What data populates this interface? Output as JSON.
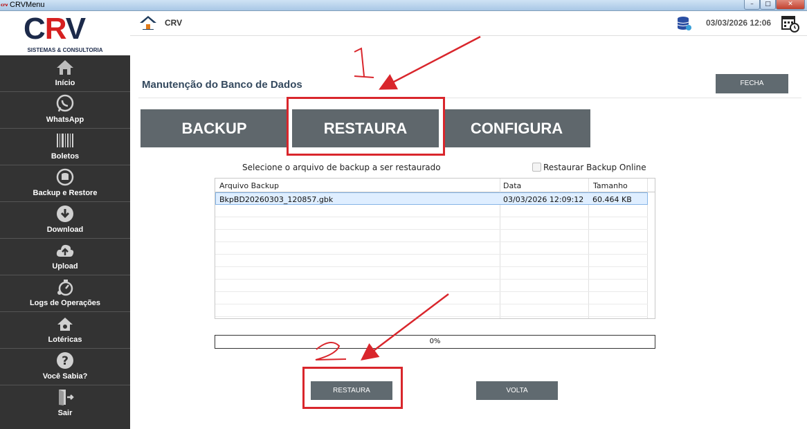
{
  "window": {
    "title": "CRVMenu"
  },
  "logo": {
    "text": "CRV",
    "subtitle": "SISTEMAS & CONSULTORIA"
  },
  "sidebar": {
    "items": [
      {
        "label": "Início",
        "icon": "home-icon"
      },
      {
        "label": "WhatsApp",
        "icon": "whatsapp-icon"
      },
      {
        "label": "Boletos",
        "icon": "barcode-icon"
      },
      {
        "label": "Backup e Restore",
        "icon": "backup-restore-icon"
      },
      {
        "label": "Download",
        "icon": "download-icon"
      },
      {
        "label": "Upload",
        "icon": "upload-icon"
      },
      {
        "label": "Logs de Operações",
        "icon": "logs-icon"
      },
      {
        "label": "Lotéricas",
        "icon": "loterica-icon"
      },
      {
        "label": "Você Sabia?",
        "icon": "question-icon"
      },
      {
        "label": "Sair",
        "icon": "exit-icon"
      }
    ]
  },
  "topbar": {
    "breadcrumb": "CRV",
    "datetime": "03/03/2026 12:06"
  },
  "page": {
    "title": "Manutenção do Banco de Dados",
    "close_label": "FECHA"
  },
  "tabs": {
    "backup": "BACKUP",
    "restaura": "RESTAURA",
    "configura": "CONFIGURA"
  },
  "restore": {
    "select_label": "Selecione o arquivo de backup a ser restaurado",
    "online_label": "Restaurar Backup Online",
    "online_checked": false,
    "columns": {
      "file": "Arquivo Backup",
      "date": "Data",
      "size": "Tamanho"
    },
    "rows": [
      {
        "file": "BkpBD20260303_120857.gbk",
        "date": "03/03/2026 12:09:12",
        "size": "60.464 KB",
        "selected": true
      }
    ],
    "progress": {
      "value": 0,
      "label": "0%"
    },
    "restore_button": "RESTAURA",
    "back_button": "VOLTA"
  },
  "annotations": {
    "step1": "1",
    "step2": "2",
    "color": "#d9262c"
  },
  "colors": {
    "sidebar_bg": "#333333",
    "button_bg": "#606a70",
    "title_color": "#34495e"
  }
}
